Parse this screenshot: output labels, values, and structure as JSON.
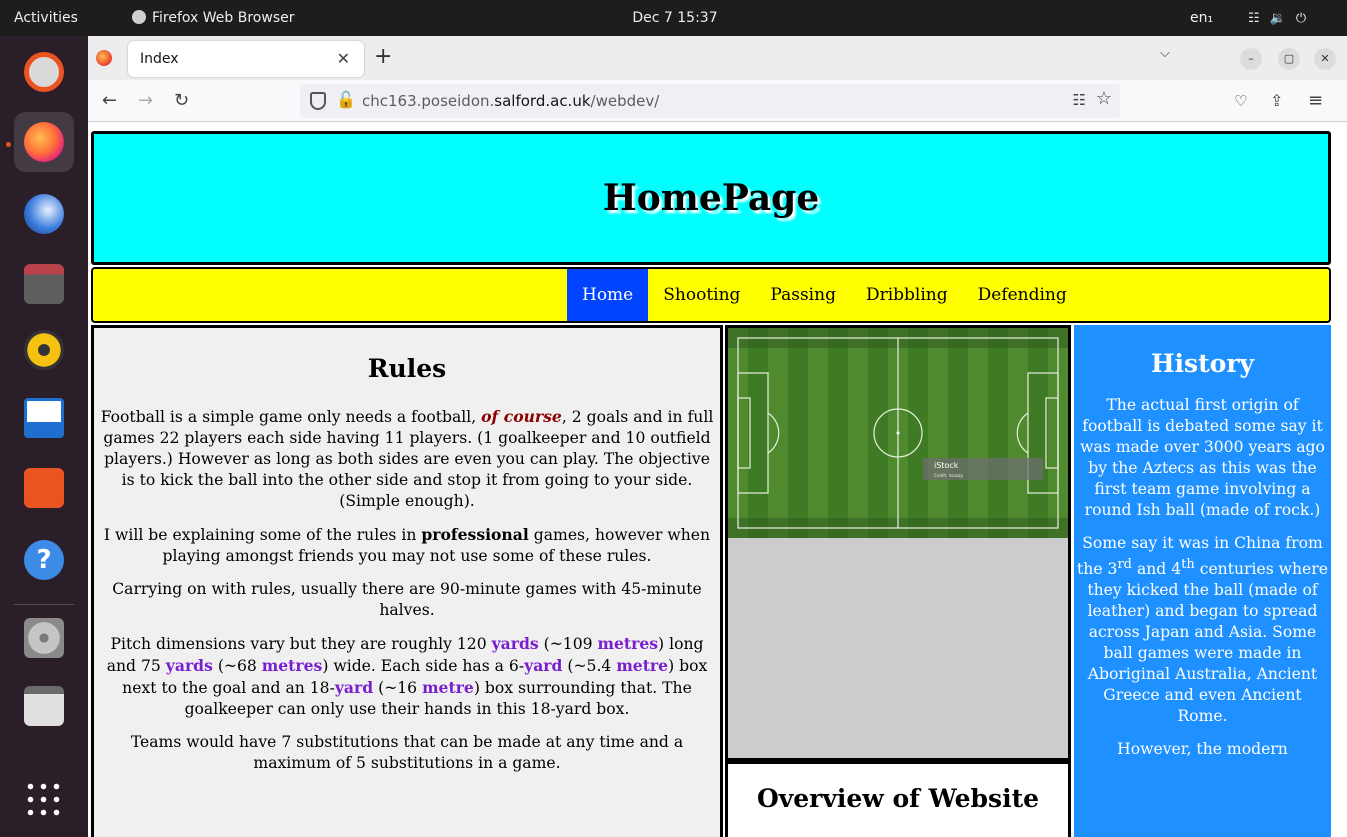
{
  "topbar": {
    "activities": "Activities",
    "app_name": "Firefox Web Browser",
    "clock": "Dec 7  15:37",
    "lang": "en₁"
  },
  "browser": {
    "tab_title": "Index",
    "url_host_pre": "chc163.poseidon.",
    "url_host_domain": "salford.ac.uk",
    "url_path": "/webdev/"
  },
  "page": {
    "header_title": "HomePage",
    "nav": [
      "Home",
      "Shooting",
      "Passing",
      "Dribbling",
      "Defending"
    ],
    "rules": {
      "title": "Rules",
      "p1_a": "Football is a simple game only needs a football, ",
      "p1_em": "of course",
      "p1_b": ", 2 goals and in full games 22 players each side having 11 players. (1 goalkeeper and 10 outfield players.) However as long as both sides are even you can play. The objective is to kick the ball into the other side and stop it from going to your side. (Simple enough).",
      "p2_a": "I will be explaining some of the rules in ",
      "p2_b": "professional",
      "p2_c": " games, however when playing amongst friends you may not use some of these rules.",
      "p3": "Carrying on with rules, usually there are 90-minute games with 45-minute halves.",
      "p4": {
        "t1": "Pitch dimensions vary but they are roughly 120 ",
        "u1": "yards",
        "t2": " (~109 ",
        "u2": "metres",
        "t3": ") long and 75 ",
        "u3": "yards",
        "t4": " (~68 ",
        "u4": "metres",
        "t5": ") wide. Each side has a 6-",
        "u5": "yard",
        "t6": " (~5.4 ",
        "u6": "metre",
        "t7": ") box next to the goal and an 18-",
        "u7": "yard",
        "t8": " (~16 ",
        "u8": "metre",
        "t9": ") box surrounding that. The goalkeeper can only use their hands in this 18-yard box."
      },
      "p5": "Teams would have 7 substitutions that can be made at any time and a maximum of 5 substitutions in a game."
    },
    "image_watermark": "iStock",
    "image_watermark_sub": "Credit: Iscazzy",
    "overview_title": "Overview of Website",
    "history": {
      "title": "History",
      "p1": "The actual first origin of football is debated some say it was made over 3000 years ago by the Aztecs as this was the first team game involving a round Ish ball (made of rock.)",
      "p2_a": "Some say it was in China from the 3",
      "p2_sup1": "rd",
      "p2_b": " and 4",
      "p2_sup2": "th",
      "p2_c": " centuries where they kicked the ball (made of leather) and began to spread across Japan and Asia. Some ball games were made in Aboriginal Australia, Ancient Greece and even Ancient Rome.",
      "p3": "However, the modern"
    }
  }
}
